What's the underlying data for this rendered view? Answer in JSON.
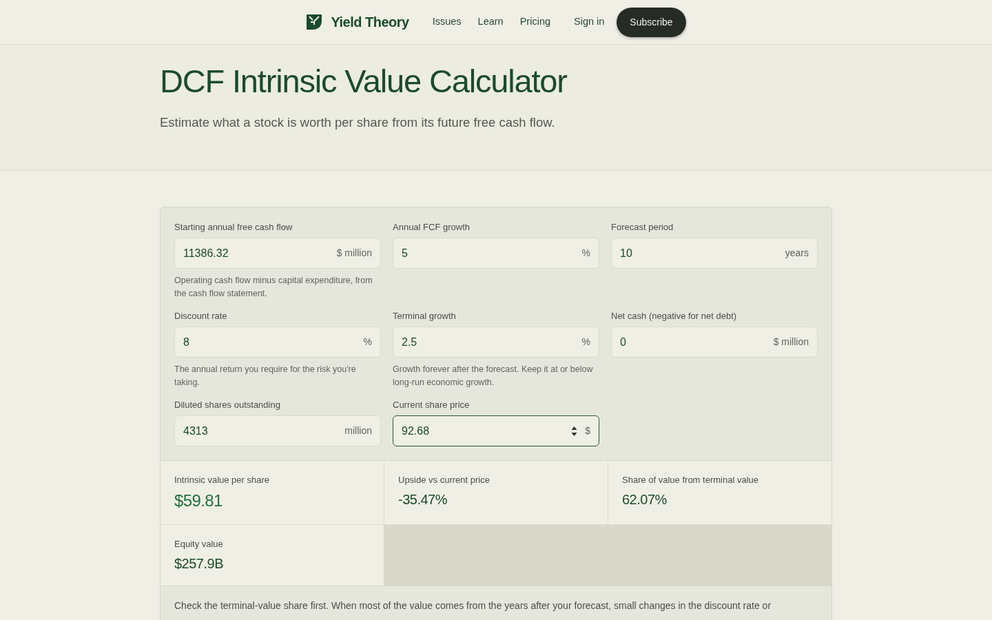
{
  "nav": {
    "brand": "Yield Theory",
    "links": [
      {
        "label": "Issues"
      },
      {
        "label": "Learn"
      },
      {
        "label": "Pricing"
      }
    ],
    "sign_in": "Sign in",
    "subscribe": "Subscribe"
  },
  "hero": {
    "title": "DCF Intrinsic Value Calculator",
    "subtitle": "Estimate what a stock is worth per share from its future free cash flow."
  },
  "calculator": {
    "fields": [
      {
        "label": "Starting annual free cash flow",
        "value": "11386.32",
        "unit": "$ million",
        "help": "Operating cash flow minus capital expenditure, from the cash flow statement.",
        "focused": false
      },
      {
        "label": "Annual FCF growth",
        "value": "5",
        "unit": "%",
        "focused": false
      },
      {
        "label": "Forecast period",
        "value": "10",
        "unit": "years",
        "focused": false
      },
      {
        "label": "Discount rate",
        "value": "8",
        "unit": "%",
        "help": "The annual return you require for the risk you're taking.",
        "focused": false
      },
      {
        "label": "Terminal growth",
        "value": "2.5",
        "unit": "%",
        "help": "Growth forever after the forecast. Keep it at or below long-run economic growth.",
        "focused": false
      },
      {
        "label": "Net cash (negative for net debt)",
        "value": "0",
        "unit": "$ million",
        "focused": false
      },
      {
        "label": "Diluted shares outstanding",
        "value": "4313",
        "unit": "million",
        "focused": false
      },
      {
        "label": "Current share price",
        "value": "92.68",
        "unit": "$",
        "focused": true
      }
    ],
    "results": [
      {
        "label": "Intrinsic value per share",
        "value": "$59.81",
        "kind": "highlight"
      },
      {
        "label": "Upside vs current price",
        "value": "-35.47%",
        "kind": "metric"
      },
      {
        "label": "Share of value from terminal value",
        "value": "62.07%",
        "kind": "metric"
      },
      {
        "label": "Equity value",
        "value": "$257.9B",
        "kind": "metric"
      }
    ],
    "note": "Check the terminal-value share first. When most of the value comes from the years after your forecast, small changes in the discount rate or"
  }
}
